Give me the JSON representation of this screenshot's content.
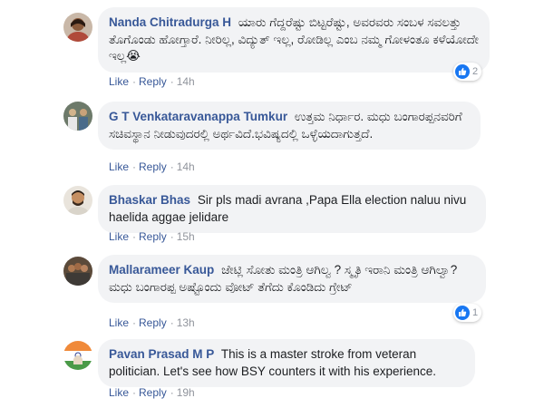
{
  "actions": {
    "like_label": "Like",
    "reply_label": "Reply",
    "separator": "·"
  },
  "colors": {
    "author": "#385898",
    "bubble": "#f2f3f5",
    "muted": "#90949c",
    "like_blue": "#1877f2"
  },
  "comments": [
    {
      "author": "Nanda Chitradurga H",
      "text": "ಯಾರು ಗೆದ್ದರೆಷ್ಟು ಬಿಟ್ಟರೆಷ್ಟು, ಅವರವರು ಸಂಬಳ ಸವಲತ್ತು ತೊಗೊಂಡು ಹೋಗ್ತಾರೆ. ನೀರಿಲ್ಲ, ವಿದ್ಯುತ್ ಇಲ್ಲ, ರೋಡಿಲ್ಲ ಎಂಬ ನಮ್ಮ ಗೋಳಂತೂ ಕಳೆಯೋದೇ ಇಲ್ಲ😭",
      "time": "14h",
      "reaction_count": "2",
      "avatar_icon": "woman-avatar-icon"
    },
    {
      "author": "G T Venkataravanappa Tumkur",
      "text": "ಉತ್ತಮ ನಿರ್ಧಾರ. ಮಧು ಬಂಗಾರಪ್ಪನವರಿಗೆ ಸಚಿವಸ್ಥಾನ ನೀಡುವುದರಲ್ಲಿ ಅರ್ಥವಿದೆ.ಭವಿಷ್ಯದಲ್ಲಿ ಒಳ್ಳೆಯದಾಗುತ್ತದೆ.",
      "time": "14h",
      "reaction_count": null,
      "avatar_icon": "group-avatar-icon"
    },
    {
      "author": "Bhaskar Bhas",
      "text": "Sir pls madi avrana ,Papa Ella election naluu nivu haelida aggae jelidare",
      "time": "15h",
      "reaction_count": null,
      "avatar_icon": "man-avatar-icon"
    },
    {
      "author": "Mallarameer Kaup",
      "text": "ಜೇಟ್ಲಿ ಸೋತು ಮಂತ್ರಿ ಆಗಿಲ್ವ ? ಸ್ಮೃತಿ ಇರಾನಿ ಮಂತ್ರಿ ಆಗಿಲ್ವಾ? ಮಧು ಬಂಗಾರಪ್ಪ ಅಷ್ಟೊಂದು ವೋಟ್ ತೆಗೆದು ಕೊಂಡಿದು ಗ್ರೇಟ್",
      "time": "13h",
      "reaction_count": "1",
      "avatar_icon": "crowd-avatar-icon"
    },
    {
      "author": "Pavan Prasad M P",
      "text": "This is a master stroke from veteran politician. Let's see how BSY counters it with his experience.",
      "time": "19h",
      "reaction_count": null,
      "avatar_icon": "flag-avatar-icon"
    }
  ]
}
